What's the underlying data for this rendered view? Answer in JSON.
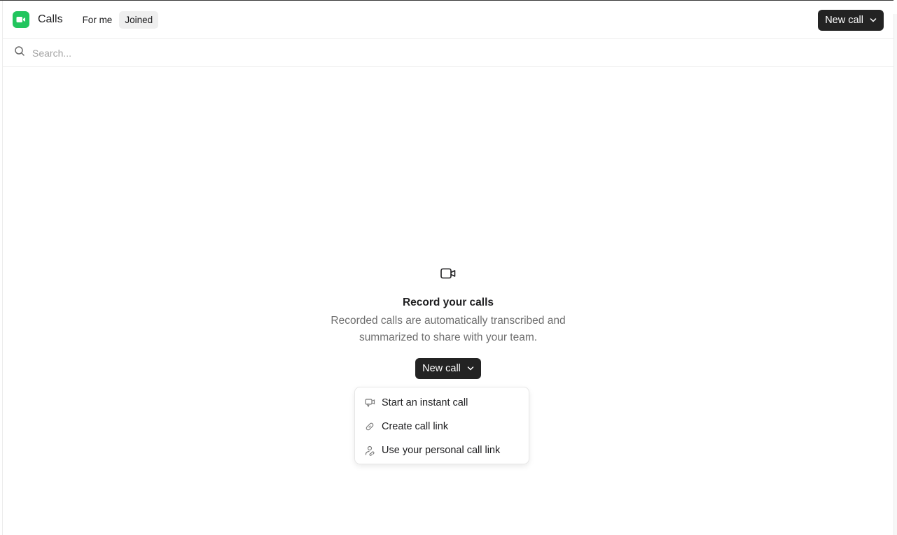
{
  "header": {
    "app_icon": "video-camera-icon",
    "title": "Calls",
    "tabs": [
      {
        "label": "For me",
        "active": false
      },
      {
        "label": "Joined",
        "active": true
      }
    ],
    "new_call_label": "New call",
    "brand_color": "#22c55e"
  },
  "search": {
    "icon": "search-icon",
    "placeholder": "Search...",
    "value": ""
  },
  "empty_state": {
    "icon": "video-camera-icon",
    "title": "Record your calls",
    "description": "Recorded calls are automatically transcribed and summarized to share with your team.",
    "new_call_label": "New call"
  },
  "dropdown": {
    "items": [
      {
        "icon": "instant-call-icon",
        "label": "Start an instant call"
      },
      {
        "icon": "link-icon",
        "label": "Create call link"
      },
      {
        "icon": "personal-link-icon",
        "label": "Use your personal call link"
      }
    ]
  }
}
